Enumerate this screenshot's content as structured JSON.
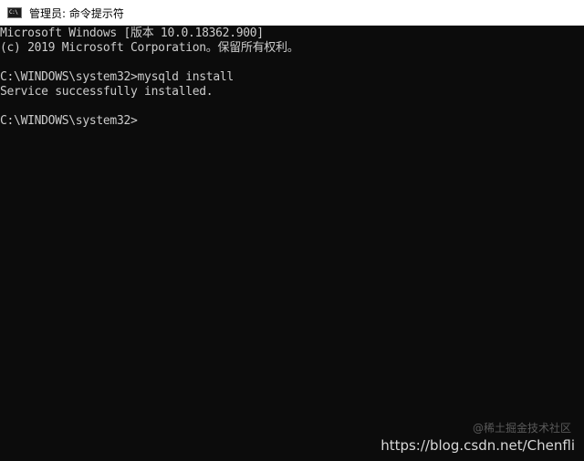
{
  "window": {
    "title": "管理员: 命令提示符",
    "icon": "cmd-icon",
    "icon_glyph": "C:\\"
  },
  "console": {
    "lines": [
      "Microsoft Windows [版本 10.0.18362.900]",
      "(c) 2019 Microsoft Corporation。保留所有权利。",
      "",
      "C:\\WINDOWS\\system32>mysqld install",
      "Service successfully installed.",
      "",
      "C:\\WINDOWS\\system32>"
    ]
  },
  "watermark": {
    "text": "https://blog.csdn.net/Chenfli",
    "faint_text": "@稀土掘金技术社区"
  },
  "colors": {
    "console_bg": "#0c0c0c",
    "console_text": "#cccccc",
    "titlebar_bg": "#ffffff"
  }
}
